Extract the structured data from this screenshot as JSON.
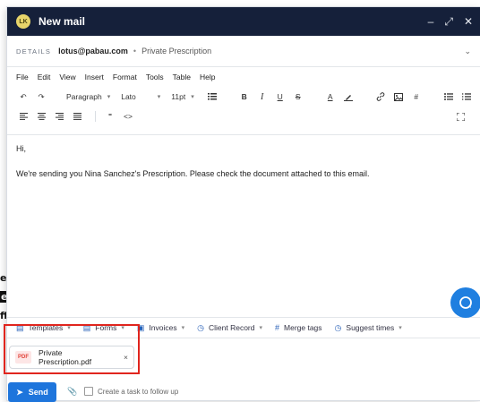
{
  "window": {
    "avatar_initials": "LK",
    "title": "New mail",
    "controls": {
      "minimize": "–",
      "expand": "⤢",
      "close": "✕"
    }
  },
  "details": {
    "label": "DETAILS",
    "from_email": "lotus@pabau.com",
    "separator": "•",
    "subject": "Private Prescription",
    "caret": "⌄"
  },
  "menubar": [
    "File",
    "Edit",
    "View",
    "Insert",
    "Format",
    "Tools",
    "Table",
    "Help"
  ],
  "toolbar": {
    "undo": "↶",
    "redo": "↷",
    "paragraph": "Paragraph",
    "font": "Lato",
    "size": "11pt",
    "bold": "B",
    "italic": "I",
    "underline": "U",
    "strike": "S",
    "text_color": "A",
    "blockquote": "\"",
    "code": "<>"
  },
  "editor": {
    "greeting": "Hi,",
    "body": "We're sending you Nina Sanchez's Prescription. Please check the document attached to this email."
  },
  "bottom_actions": [
    {
      "label": "Templates",
      "icon": "document-icon"
    },
    {
      "label": "Forms",
      "icon": "form-icon"
    },
    {
      "label": "Invoices",
      "icon": "invoice-icon"
    },
    {
      "label": "Client Record",
      "icon": "clock-icon"
    },
    {
      "label": "Merge tags",
      "icon": "hashtag-icon"
    },
    {
      "label": "Suggest times",
      "icon": "clock-icon"
    }
  ],
  "attachment": {
    "type_badge": "PDF",
    "file_name": "Private Prescription.pdf",
    "remove": "×"
  },
  "footer": {
    "send_label": "Send",
    "task_label": "Create a task to follow up"
  },
  "background_fragments": [
    "ef",
    "e",
    "ff"
  ],
  "colors": {
    "header_bg": "#15203a",
    "accent": "#1e75dc",
    "highlight_border": "#e0251e"
  }
}
